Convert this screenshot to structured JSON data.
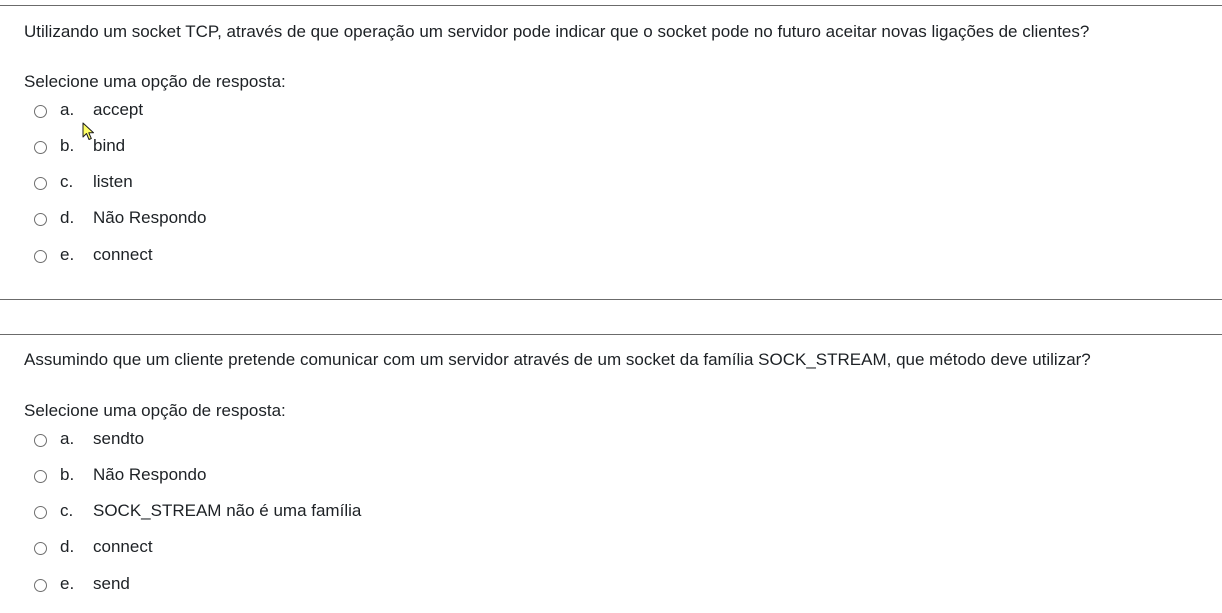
{
  "questions": [
    {
      "text": "Utilizando um socket TCP, através de que operação um servidor pode indicar que o socket pode no futuro aceitar novas ligações de clientes?",
      "prompt": "Selecione uma opção de resposta:",
      "options": [
        {
          "letter": "a.",
          "text": "accept"
        },
        {
          "letter": "b.",
          "text": "bind"
        },
        {
          "letter": "c.",
          "text": "listen"
        },
        {
          "letter": "d.",
          "text": "Não Respondo"
        },
        {
          "letter": "e.",
          "text": "connect"
        }
      ]
    },
    {
      "text": "Assumindo que um cliente pretende comunicar com um servidor através de um socket da família SOCK_STREAM, que método deve utilizar?",
      "prompt": "Selecione uma opção de resposta:",
      "options": [
        {
          "letter": "a.",
          "text": "sendto"
        },
        {
          "letter": "b.",
          "text": "Não Respondo"
        },
        {
          "letter": "c.",
          "text": "SOCK_STREAM não é uma família"
        },
        {
          "letter": "d.",
          "text": "connect"
        },
        {
          "letter": "e.",
          "text": "send"
        }
      ]
    }
  ],
  "colors": {
    "text": "#1d2125",
    "divider": "#6b6b6b",
    "radio_border": "#6f6f6f",
    "cursor_fill": "#ffff66"
  },
  "icons": {
    "radio": "radio-unchecked-icon",
    "cursor": "mouse-pointer-icon"
  }
}
